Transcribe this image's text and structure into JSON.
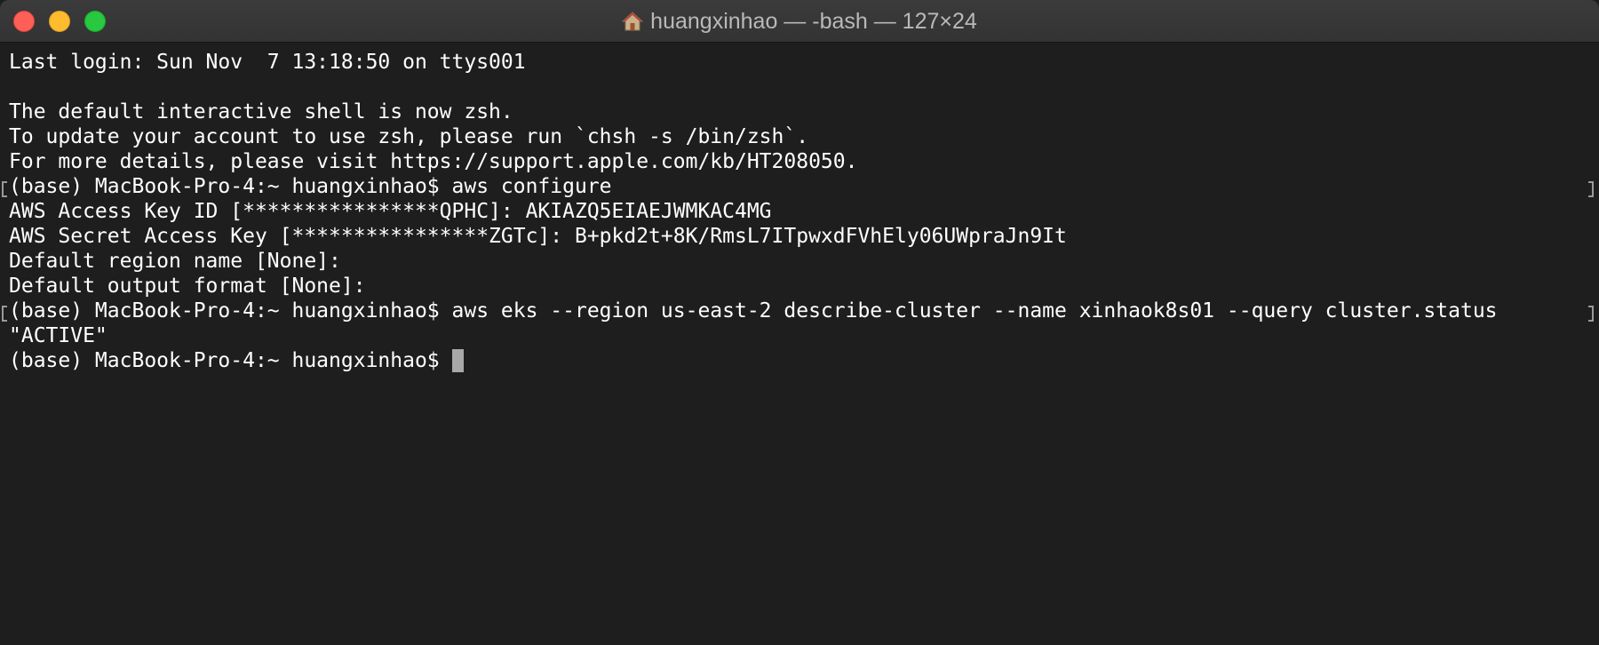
{
  "window": {
    "title": "huangxinhao — -bash — 127×24",
    "title_icon": "home-icon",
    "controls": [
      "close",
      "minimize",
      "zoom"
    ]
  },
  "terminal": {
    "lines": [
      "Last login: Sun Nov  7 13:18:50 on ttys001",
      "",
      "The default interactive shell is now zsh.",
      "To update your account to use zsh, please run `chsh -s /bin/zsh`.",
      "For more details, please visit https://support.apple.com/kb/HT208050.",
      "(base) MacBook-Pro-4:~ huangxinhao$ aws configure",
      "AWS Access Key ID [****************QPHC]: AKIAZQ5EIAEJWMKAC4MG",
      "AWS Secret Access Key [****************ZGTc]: 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",
      "Default region name [None]:",
      "Default output format [None]:",
      "(base) MacBook-Pro-4:~ huangxinhao$ aws eks --region us-east-2 describe-cluster --name xinhaok8s01 --query cluster.status",
      "\"ACTIVE\"",
      "(base) MacBook-Pro-4:~ huangxinhao$ "
    ]
  },
  "colors": {
    "background": "#1e1e1e",
    "text": "#ffffff",
    "cursor": "#a8a8a8",
    "close": "#fe5f57",
    "minimize": "#febc2e",
    "zoom": "#28c840"
  }
}
